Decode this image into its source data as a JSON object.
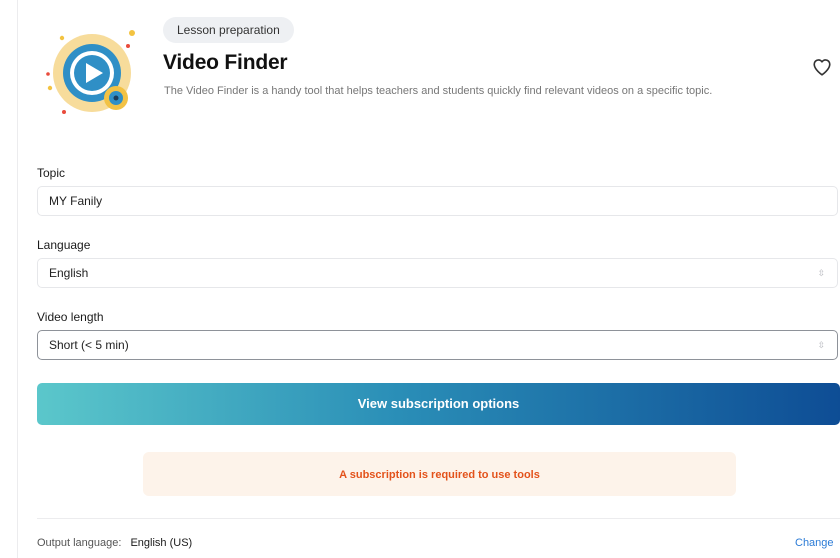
{
  "header": {
    "badge": "Lesson preparation",
    "title": "Video Finder",
    "description": "The Video Finder is a handy tool that helps teachers and students quickly find relevant videos on a specific topic.",
    "hero_icon": "video-play-icon",
    "favorite_icon": "heart-icon"
  },
  "form": {
    "topic": {
      "label": "Topic",
      "value": "MY Fanily"
    },
    "language": {
      "label": "Language",
      "value": "English"
    },
    "video_length": {
      "label": "Video length",
      "value": "Short (< 5 min)"
    }
  },
  "cta": {
    "label": "View subscription options"
  },
  "notice": {
    "text": "A subscription is required to use tools"
  },
  "footer": {
    "output_language_label": "Output language:",
    "output_language_value": "English (US)",
    "change_label": "Change"
  },
  "colors": {
    "accent_start": "#5bc7cb",
    "accent_end": "#0e4d95",
    "warning_text": "#e3521b",
    "warning_bg": "#fdf3ea",
    "link": "#2b7bd6"
  }
}
